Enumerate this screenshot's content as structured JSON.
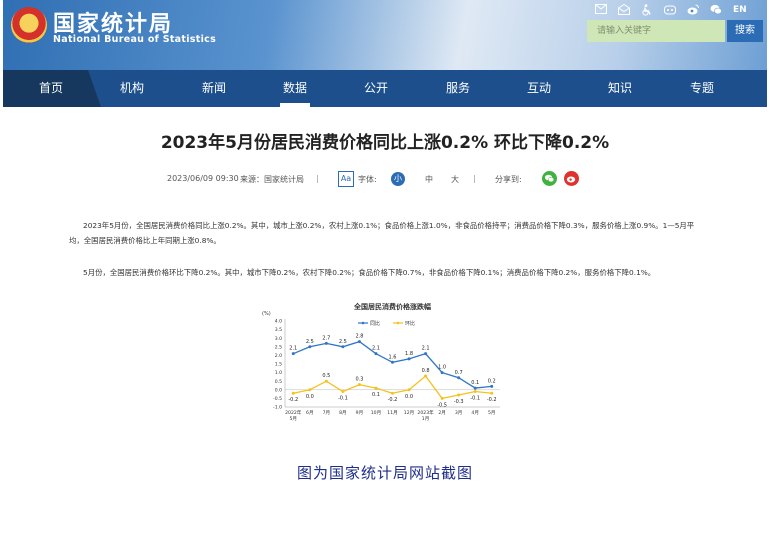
{
  "header": {
    "logo_cn": "国家统计局",
    "logo_en": "National Bureau of Statistics",
    "lang": "EN",
    "search_placeholder": "请输入关键字",
    "search_button": "搜索"
  },
  "nav": {
    "items": [
      "首页",
      "机构",
      "新闻",
      "数据",
      "公开",
      "服务",
      "互动",
      "知识",
      "专题"
    ],
    "active": "数据"
  },
  "article": {
    "title": "2023年5月份居民消费价格同比上涨0.2% 环比下降0.2%",
    "date": "2023/06/09 09:30",
    "source": "来源：国家统计局",
    "font_label": "字体:",
    "font_small": "小",
    "font_medium": "中",
    "font_large": "大",
    "share_label": "分享到:",
    "paragraph1": "2023年5月份，全国居民消费价格同比上涨0.2%。其中，城市上涨0.2%，农村上涨0.1%；食品价格上涨1.0%，非食品价格持平；消费品价格下降0.3%，服务价格上涨0.9%。1—5月平均，全国居民消费价格比上年同期上涨0.8%。",
    "paragraph2": "5月份，全国居民消费价格环比下降0.2%。其中，城市下降0.2%，农村下降0.2%；食品价格下降0.7%，非食品价格下降0.1%；消费品价格下降0.2%，服务价格下降0.1%。"
  },
  "chart_data": {
    "type": "line",
    "title": "全国居民消费价格涨跌幅",
    "ylabel": "(%)",
    "ylim": [
      -1.0,
      4.0
    ],
    "yticks": [
      "4.0",
      "3.5",
      "3.0",
      "2.5",
      "2.0",
      "1.5",
      "1.0",
      "0.5",
      "0.0",
      "-0.5",
      "-1.0"
    ],
    "categories": [
      "2022年5月",
      "6月",
      "7月",
      "8月",
      "9月",
      "10月",
      "11月",
      "12月",
      "2023年1月",
      "2月",
      "3月",
      "4月",
      "5月"
    ],
    "series": [
      {
        "name": "同比",
        "color": "#2e75c7",
        "values": [
          2.1,
          2.5,
          2.7,
          2.5,
          2.8,
          2.1,
          1.6,
          1.8,
          2.1,
          1.0,
          0.7,
          0.1,
          0.2
        ]
      },
      {
        "name": "环比",
        "color": "#f5c21b",
        "values": [
          -0.2,
          0.0,
          0.5,
          -0.1,
          0.3,
          0.1,
          -0.2,
          0.0,
          0.8,
          -0.5,
          -0.3,
          -0.1,
          -0.2
        ]
      }
    ],
    "legend": "top"
  },
  "caption": "图为国家统计局网站截图"
}
